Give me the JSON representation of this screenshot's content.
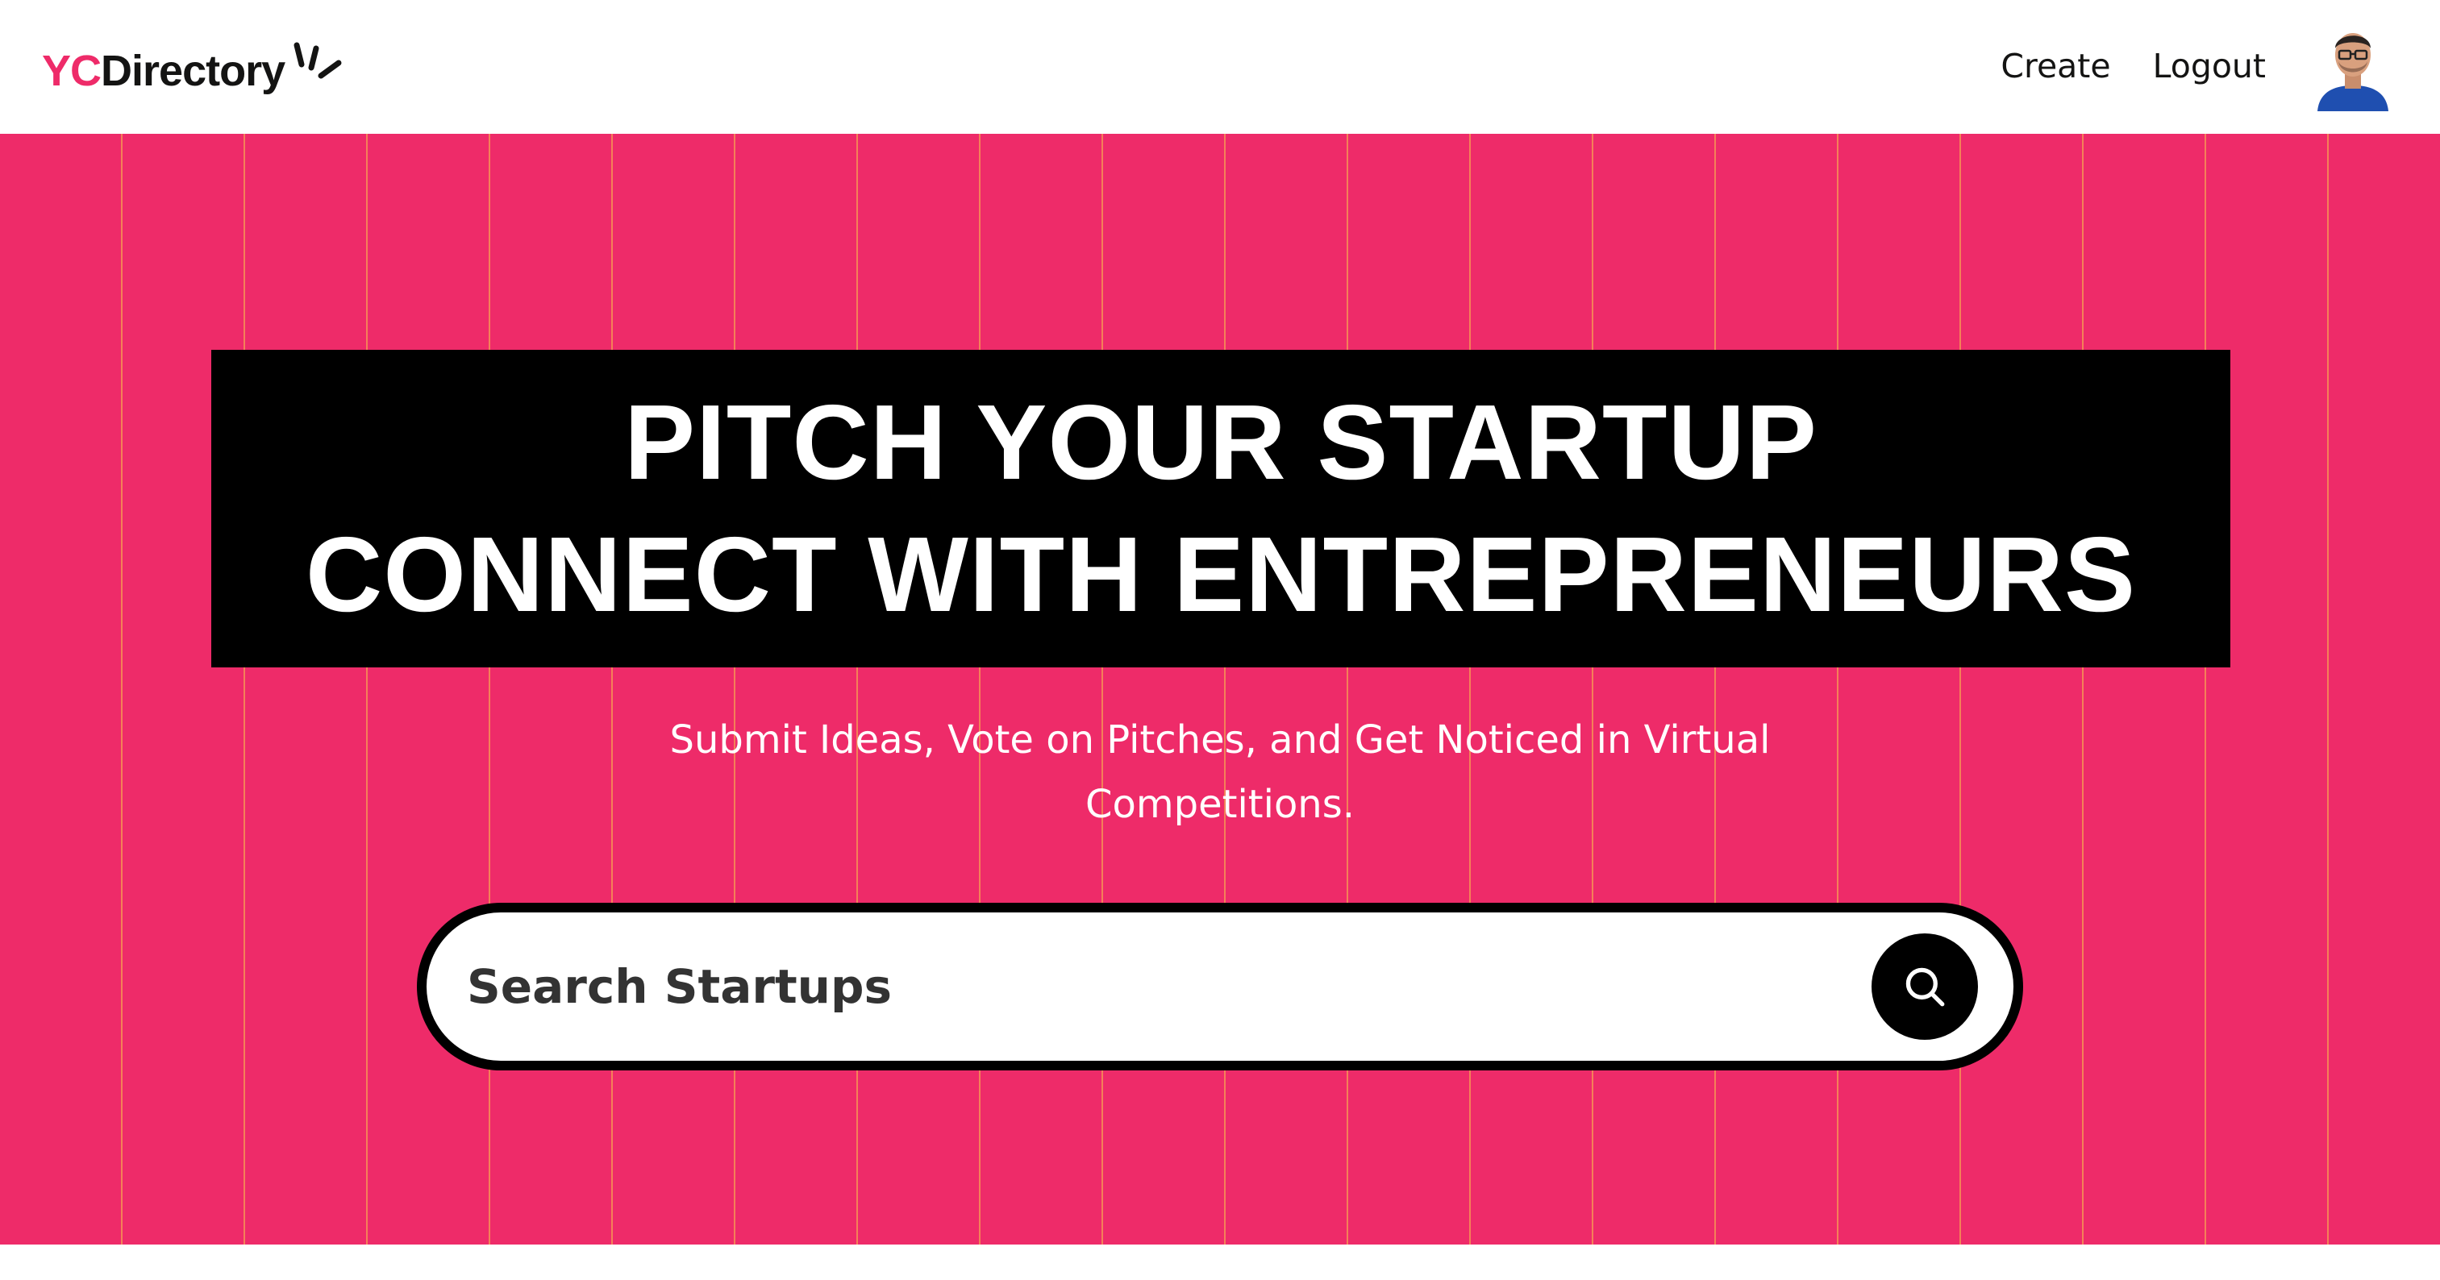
{
  "navbar": {
    "logo_prefix": "YC",
    "logo_suffix": "Directory",
    "links": {
      "create": "Create",
      "logout": "Logout"
    },
    "avatar_icon": "user-avatar-icon"
  },
  "hero": {
    "heading_line1": "PITCH YOUR STARTUP",
    "heading_line2": "CONNECT WITH ENTREPRENEURS",
    "subheading": "Submit Ideas, Vote on Pitches, and Get Noticed in Virtual Competitions.",
    "search": {
      "placeholder": "Search Startups",
      "value": "",
      "button_icon": "search-icon"
    }
  },
  "colors": {
    "brand_pink": "#ee2b69",
    "black": "#000000",
    "white": "#ffffff",
    "grid_line": "#fbe843"
  }
}
